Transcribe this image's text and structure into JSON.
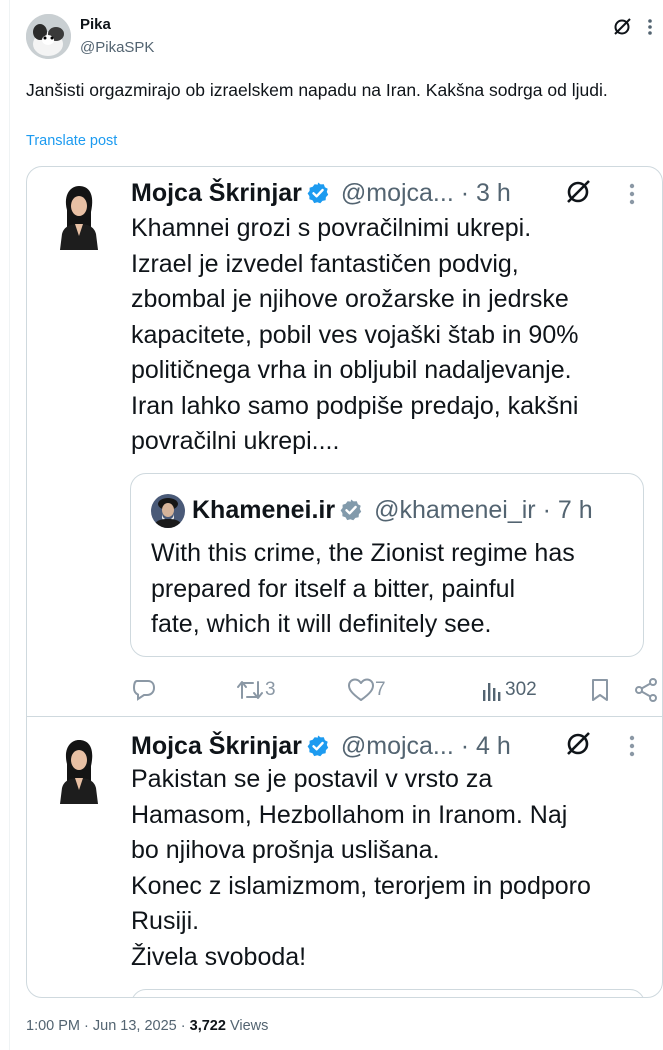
{
  "post": {
    "author_name": "Pika",
    "author_handle": "@PikaSPK",
    "text": "Janšisti orgazmirajo ob izraelskem napadu na Iran. Kakšna sodrga od ljudi.",
    "translate_label": "Translate post",
    "timestamp": "1:00 PM · Jun 13, 2025 · ",
    "views_count": "3,722",
    "views_label": " Views"
  },
  "tweets": [
    {
      "author_name": "Mojca Škrinjar",
      "author_handle": "@mojca...",
      "time": "· 3 h",
      "lines": [
        "Khamnei grozi s povračilnimi ukrepi.",
        "Izrael je izvedel fantastičen podvig,",
        "zbombal je njihove orožarske in jedrske",
        "kapacitete, pobil ves vojaški štab in 90%",
        "političnega vrha in obljubil nadaljevanje.",
        "Iran lahko samo podpiše predajo, kakšni",
        "povračilni ukrepi...."
      ],
      "quote": {
        "author_name": "Khamenei.ir",
        "author_handle": "@khamenei_ir",
        "time": "· 7 h",
        "lines": [
          "With this crime, the Zionist regime has",
          "prepared for itself a bitter, painful",
          "fate, which it will definitely see."
        ]
      },
      "actions": {
        "reply_count": "",
        "retweet_count": "3",
        "like_count": "7",
        "views_count": "302"
      }
    },
    {
      "author_name": "Mojca Škrinjar",
      "author_handle": "@mojca...",
      "time": "· 4 h",
      "lines": [
        "Pakistan se je postavil v vrsto za",
        "Hamasom, Hezbollahom in Iranom. Naj",
        "bo njihova prošnja uslišana.",
        "Konec z islamizmom, terorjem in podporo",
        "Rusiji.",
        "Živela svoboda!"
      ]
    }
  ],
  "colors": {
    "accent": "#1d9bf0",
    "text": "#0f1419",
    "muted": "#536471",
    "border": "#cfd9de"
  },
  "icons": [
    "grok-icon",
    "more-icon",
    "verified-badge-icon",
    "reply-icon",
    "retweet-icon",
    "like-icon",
    "views-icon",
    "bookmark-icon",
    "share-icon"
  ]
}
